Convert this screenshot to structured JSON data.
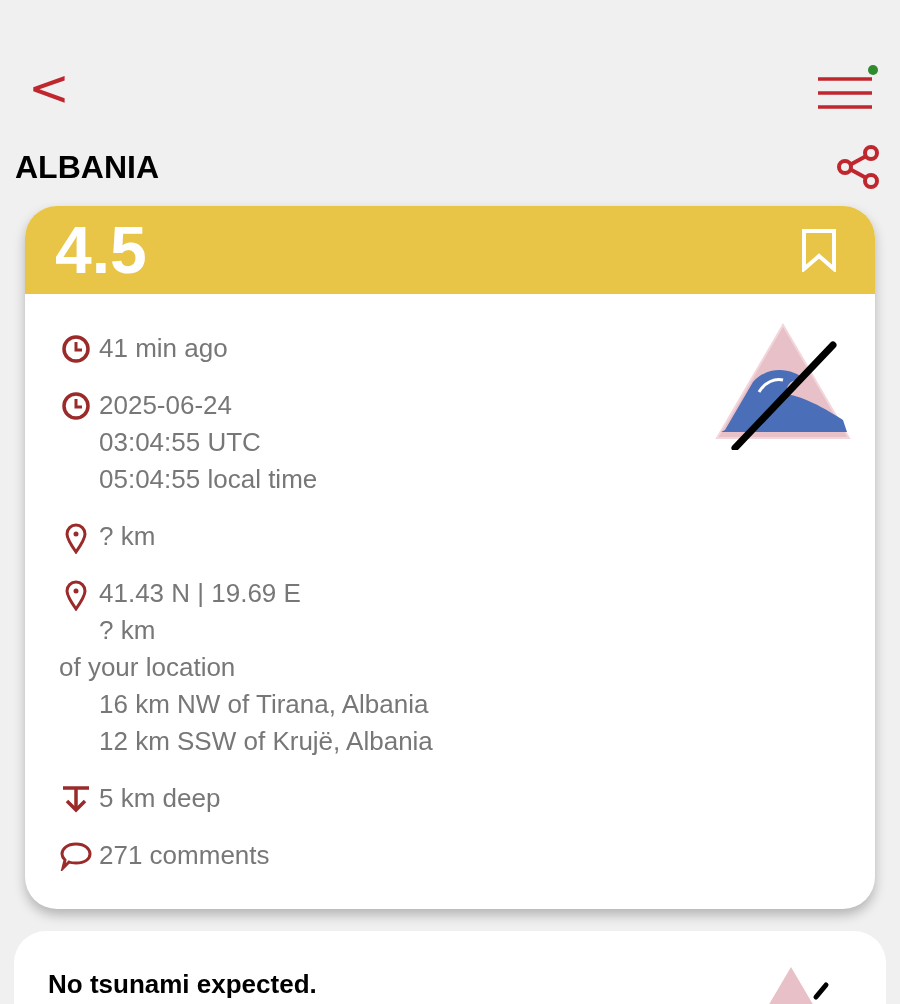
{
  "top_bar": {
    "back": "<",
    "menu_notification": true
  },
  "region": "ALBANIA",
  "quake": {
    "magnitude": "4.5",
    "bookmarked": false,
    "details": [
      {
        "kind": "clock",
        "lines": [
          "41 min ago"
        ]
      },
      {
        "kind": "clock",
        "lines": [
          "2025-06-24",
          "03:04:55 UTC",
          "05:04:55 local time"
        ]
      },
      {
        "kind": "pin",
        "lines": [
          "? km"
        ]
      },
      {
        "kind": "pin",
        "lines": [
          "41.43 N | 19.69 E",
          "? km"
        ]
      },
      {
        "kind": "label",
        "lines": [
          "of your location"
        ]
      },
      {
        "kind": "sub",
        "lines": [
          "16 km NW of Tirana, Albania",
          "12 km SSW of Krujë, Albania"
        ]
      },
      {
        "kind": "depth",
        "lines": [
          "5 km deep"
        ]
      },
      {
        "kind": "comment",
        "lines": [
          "271 comments"
        ]
      }
    ]
  },
  "tsunami": {
    "message": "No tsunami expected."
  }
}
